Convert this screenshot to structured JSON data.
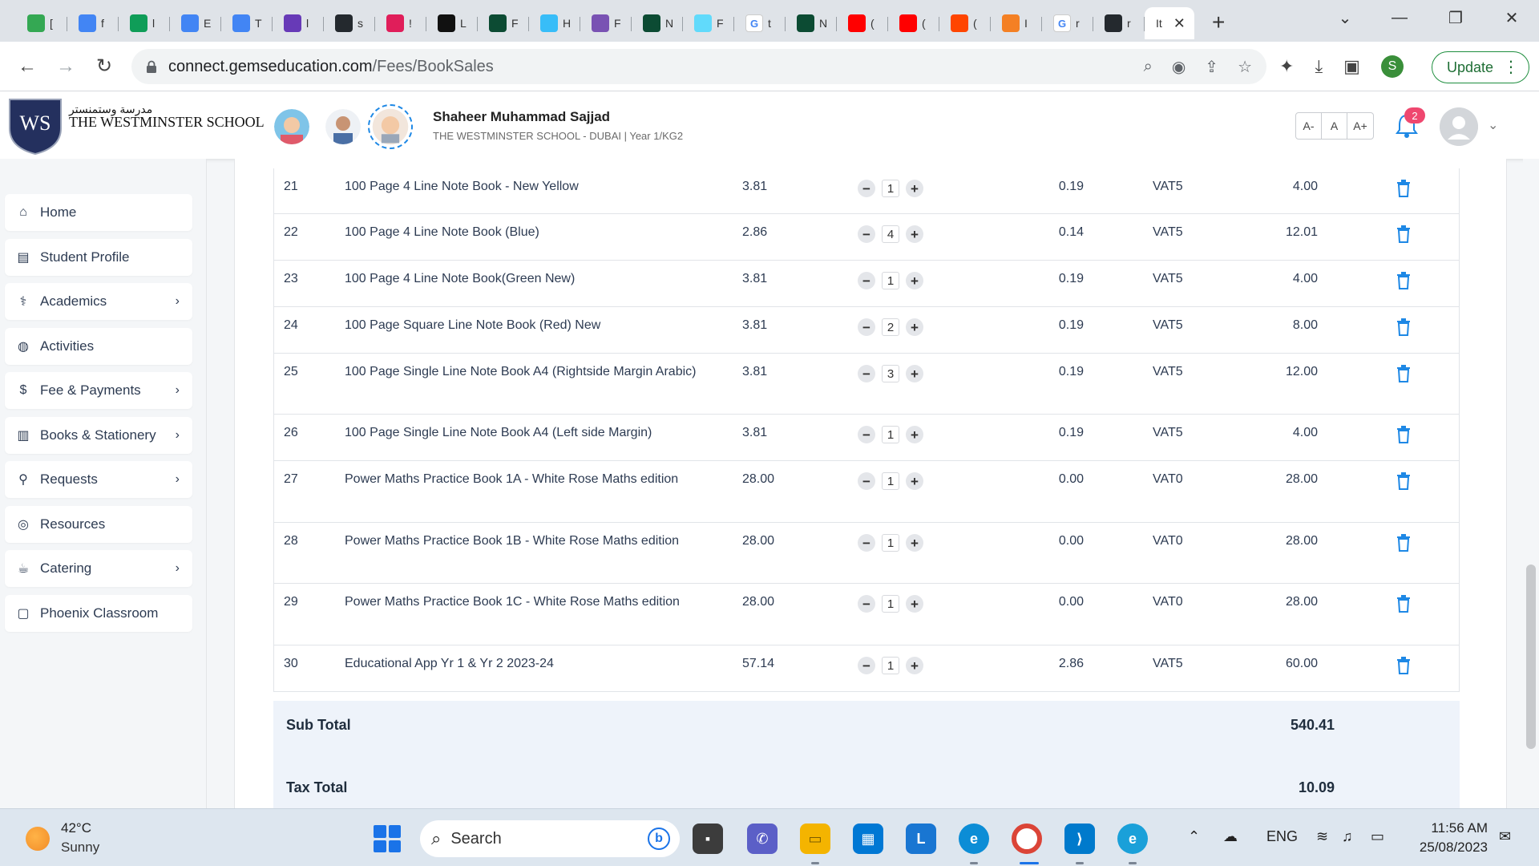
{
  "browser": {
    "tabs": [
      {
        "icon": "google-drive-icon",
        "label": "[",
        "color": "#34a853"
      },
      {
        "icon": "google-docs-icon",
        "label": "f",
        "color": "#4285f4"
      },
      {
        "icon": "google-sheets-icon",
        "label": "l",
        "color": "#0f9d58"
      },
      {
        "icon": "google-docs-icon",
        "label": "E",
        "color": "#4285f4"
      },
      {
        "icon": "google-docs-icon",
        "label": "T",
        "color": "#4285f4"
      },
      {
        "icon": "google-forms-icon",
        "label": "l",
        "color": "#673ab7"
      },
      {
        "icon": "github-icon",
        "label": "s",
        "color": "#24292e"
      },
      {
        "icon": "slack-icon",
        "label": "!",
        "color": "#e01e5a"
      },
      {
        "icon": "dark-app-icon",
        "label": "L",
        "color": "#111111"
      },
      {
        "icon": "django-icon",
        "label": "F",
        "color": "#0c4b33"
      },
      {
        "icon": "tailwind-icon",
        "label": "H",
        "color": "#38bdf8"
      },
      {
        "icon": "bootstrap-icon",
        "label": "F",
        "color": "#7952b3"
      },
      {
        "icon": "django-icon",
        "label": "N",
        "color": "#0c4b33"
      },
      {
        "icon": "react-icon",
        "label": "F",
        "color": "#61dafb"
      },
      {
        "icon": "google-icon",
        "label": "t",
        "color": "#ffffff"
      },
      {
        "icon": "django-icon",
        "label": "N",
        "color": "#0c4b33"
      },
      {
        "icon": "youtube-icon",
        "label": "(",
        "color": "#ff0000"
      },
      {
        "icon": "youtube-icon",
        "label": "(",
        "color": "#ff0000"
      },
      {
        "icon": "reddit-icon",
        "label": "(",
        "color": "#ff4500"
      },
      {
        "icon": "stackoverflow-icon",
        "label": "I",
        "color": "#f48024"
      },
      {
        "icon": "google-icon",
        "label": "r",
        "color": "#ffffff"
      },
      {
        "icon": "github-icon",
        "label": "r",
        "color": "#24292e"
      }
    ],
    "active_tab_label": "It",
    "url_host": "connect.gemseducation.com",
    "url_path": "/Fees/BookSales",
    "update_label": "Update",
    "profile_initial": "S"
  },
  "header": {
    "school_arabic": "مدرسة وستمنستر",
    "school_name": "THE WESTMINSTER SCHOOL",
    "crest_text": "WS",
    "student_name": "Shaheer Muhammad Sajjad",
    "student_sub": "THE WESTMINSTER SCHOOL - DUBAI | Year 1/KG2",
    "font_controls": [
      "A-",
      "A",
      "A+"
    ],
    "notification_count": "2"
  },
  "sidebar": {
    "items": [
      {
        "label": "Home",
        "icon": "home-icon",
        "has_chevron": false
      },
      {
        "label": "Student Profile",
        "icon": "profile-card-icon",
        "has_chevron": false
      },
      {
        "label": "Academics",
        "icon": "academics-icon",
        "has_chevron": true
      },
      {
        "label": "Activities",
        "icon": "basketball-icon",
        "has_chevron": false
      },
      {
        "label": "Fee & Payments",
        "icon": "payments-icon",
        "has_chevron": true
      },
      {
        "label": "Books & Stationery",
        "icon": "books-icon",
        "has_chevron": true
      },
      {
        "label": "Requests",
        "icon": "requests-icon",
        "has_chevron": true
      },
      {
        "label": "Resources",
        "icon": "resources-icon",
        "has_chevron": false
      },
      {
        "label": "Catering",
        "icon": "catering-icon",
        "has_chevron": true
      },
      {
        "label": "Phoenix Classroom",
        "icon": "classroom-icon",
        "has_chevron": false
      }
    ]
  },
  "table": {
    "rows": [
      {
        "no": "21",
        "desc": "100 Page 4 Line Note Book - New Yellow",
        "price": "3.81",
        "qty": "1",
        "tax": "0.19",
        "code": "VAT5",
        "total": "4.00"
      },
      {
        "no": "22",
        "desc": "100 Page 4 Line Note Book (Blue)",
        "price": "2.86",
        "qty": "4",
        "tax": "0.14",
        "code": "VAT5",
        "total": "12.01"
      },
      {
        "no": "23",
        "desc": "100 Page 4 Line Note Book(Green New)",
        "price": "3.81",
        "qty": "1",
        "tax": "0.19",
        "code": "VAT5",
        "total": "4.00"
      },
      {
        "no": "24",
        "desc": "100 Page Square Line Note Book (Red) New",
        "price": "3.81",
        "qty": "2",
        "tax": "0.19",
        "code": "VAT5",
        "total": "8.00"
      },
      {
        "no": "25",
        "desc": "100 Page Single Line Note Book A4 (Rightside Margin Arabic)",
        "price": "3.81",
        "qty": "3",
        "tax": "0.19",
        "code": "VAT5",
        "total": "12.00"
      },
      {
        "no": "26",
        "desc": "100 Page Single Line Note Book A4 (Left side Margin)",
        "price": "3.81",
        "qty": "1",
        "tax": "0.19",
        "code": "VAT5",
        "total": "4.00"
      },
      {
        "no": "27",
        "desc": "Power Maths Practice Book 1A - White Rose Maths edition",
        "price": "28.00",
        "qty": "1",
        "tax": "0.00",
        "code": "VAT0",
        "total": "28.00"
      },
      {
        "no": "28",
        "desc": "Power Maths Practice Book 1B - White Rose Maths edition",
        "price": "28.00",
        "qty": "1",
        "tax": "0.00",
        "code": "VAT0",
        "total": "28.00"
      },
      {
        "no": "29",
        "desc": "Power Maths Practice Book 1C - White Rose Maths edition",
        "price": "28.00",
        "qty": "1",
        "tax": "0.00",
        "code": "VAT0",
        "total": "28.00"
      },
      {
        "no": "30",
        "desc": "Educational App Yr 1 & Yr 2 2023-24",
        "price": "57.14",
        "qty": "1",
        "tax": "2.86",
        "code": "VAT5",
        "total": "60.00"
      }
    ],
    "sub_total_label": "Sub Total",
    "sub_total_value": "540.41",
    "tax_total_label": "Tax Total",
    "tax_total_value": "10.09"
  },
  "taskbar": {
    "weather_temp": "42°C",
    "weather_cond": "Sunny",
    "search_label": "Search",
    "lang": "ENG",
    "time": "11:56 AM",
    "date": "25/08/2023"
  },
  "colors": {
    "accent": "#1e88e5",
    "sidebar_text": "#2d3b52",
    "totals_bg": "#eef3fa",
    "badge": "#ef476f"
  }
}
